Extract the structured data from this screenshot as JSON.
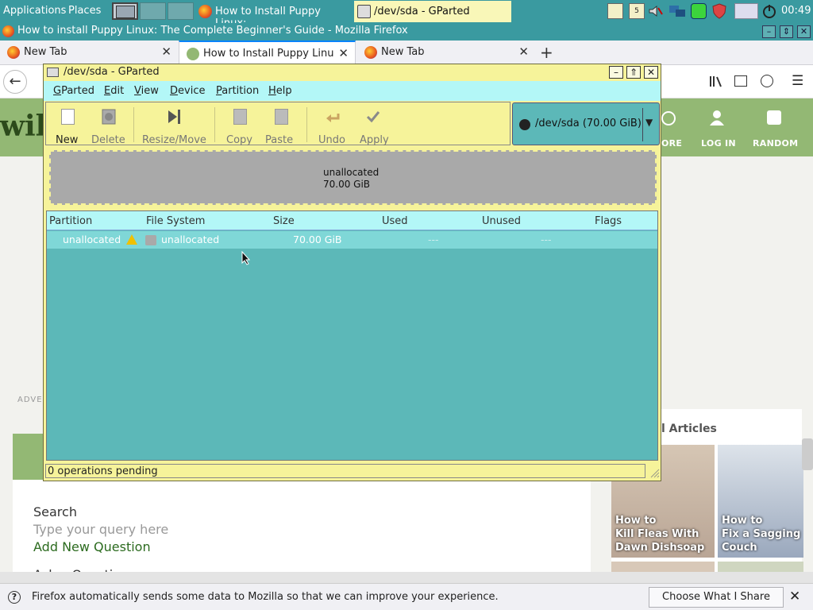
{
  "panel": {
    "applications": "Applications",
    "places": "Places",
    "task_firefox": "How to Install Puppy Linux:",
    "task_gparted": "/dev/sda - GParted",
    "clock": "00:49"
  },
  "firefox": {
    "window_title": "How to install Puppy Linux: The Complete Beginner's Guide - Mozilla Firefox",
    "tabs": [
      {
        "label": "New Tab"
      },
      {
        "label": "How to Install Puppy Linu"
      },
      {
        "label": "New Tab"
      }
    ]
  },
  "page": {
    "logo_text": "wik",
    "nav_more": "ORE",
    "nav_login": "LOG IN",
    "nav_random": "RANDOM",
    "advert": "ADVE",
    "search_label": "Search",
    "query_placeholder": "Type your query here",
    "add_question": "Add New Question",
    "ask_question": "Ask a Question",
    "related_title": "l Articles",
    "related": [
      {
        "line1": "How to",
        "line2": "Kill Fleas With",
        "line3": "Dawn Dishsoap"
      },
      {
        "line1": "How to",
        "line2": "Fix a Sagging",
        "line3": "Couch"
      }
    ]
  },
  "notification": {
    "message": "Firefox automatically sends some data to Mozilla so that we can improve your experience.",
    "button": "Choose What I Share"
  },
  "gparted": {
    "title": "/dev/sda - GParted",
    "menu": [
      "GParted",
      "Edit",
      "View",
      "Device",
      "Partition",
      "Help"
    ],
    "toolbar": {
      "new": "New",
      "delete": "Delete",
      "resize": "Resize/Move",
      "copy": "Copy",
      "paste": "Paste",
      "undo": "Undo",
      "apply": "Apply"
    },
    "device": "/dev/sda  (70.00 GiB)",
    "diskmap": {
      "label": "unallocated",
      "size": "70.00 GiB"
    },
    "columns": [
      "Partition",
      "File System",
      "Size",
      "Used",
      "Unused",
      "Flags"
    ],
    "rows": [
      {
        "partition": "unallocated",
        "filesystem": "unallocated",
        "size": "70.00 GiB",
        "used": "---",
        "unused": "---",
        "flags": ""
      }
    ],
    "status": "0 operations pending"
  },
  "colors": {
    "panel": "#3a9aa0",
    "gparted_bg": "#f6f39a",
    "table_bg": "#5cb8b8",
    "menu_bg": "#b3f7f7",
    "wiki_green": "#93b874"
  }
}
